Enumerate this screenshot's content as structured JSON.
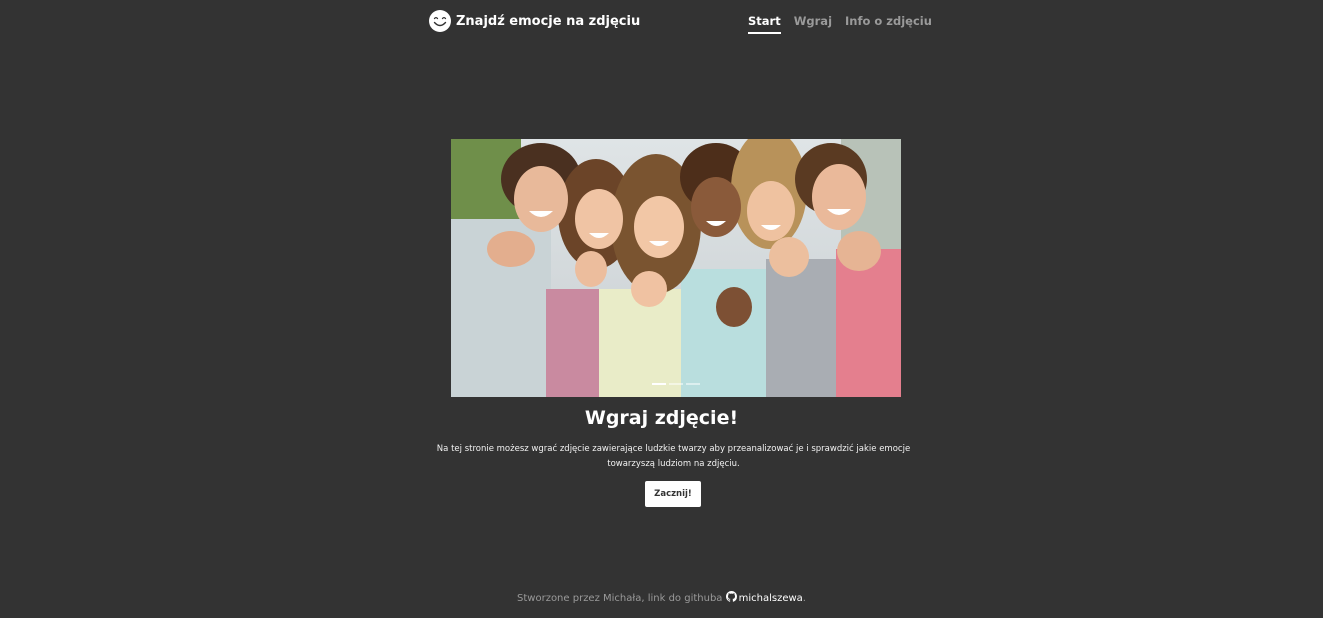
{
  "header": {
    "brand_icon": "smiley-icon",
    "brand_title": "Znajdź emocje na zdjęciu",
    "nav": [
      {
        "label": "Start",
        "active": true
      },
      {
        "label": "Wgraj",
        "active": false
      },
      {
        "label": "Info o zdjęciu",
        "active": false
      }
    ]
  },
  "carousel": {
    "image_description_icon": "photo-group-of-friends-pointing",
    "slides": 3,
    "active_slide": 1
  },
  "main": {
    "title": "Wgraj zdjęcie!",
    "description": "Na tej stronie możesz wgrać zdjęcie zawierające ludzkie twarzy aby przeanalizować je i sprawdzić jakie emocje towarzyszą ludziom na zdjęciu.",
    "button_label": "Zacznij!"
  },
  "footer": {
    "text_prefix": "Stworzone przez Michała, link do githuba",
    "link_icon": "github-icon",
    "link_label": "michalszewa",
    "text_suffix": "."
  },
  "colors": {
    "background": "#333333",
    "text": "#ffffff",
    "muted": "#9a9a9a"
  }
}
